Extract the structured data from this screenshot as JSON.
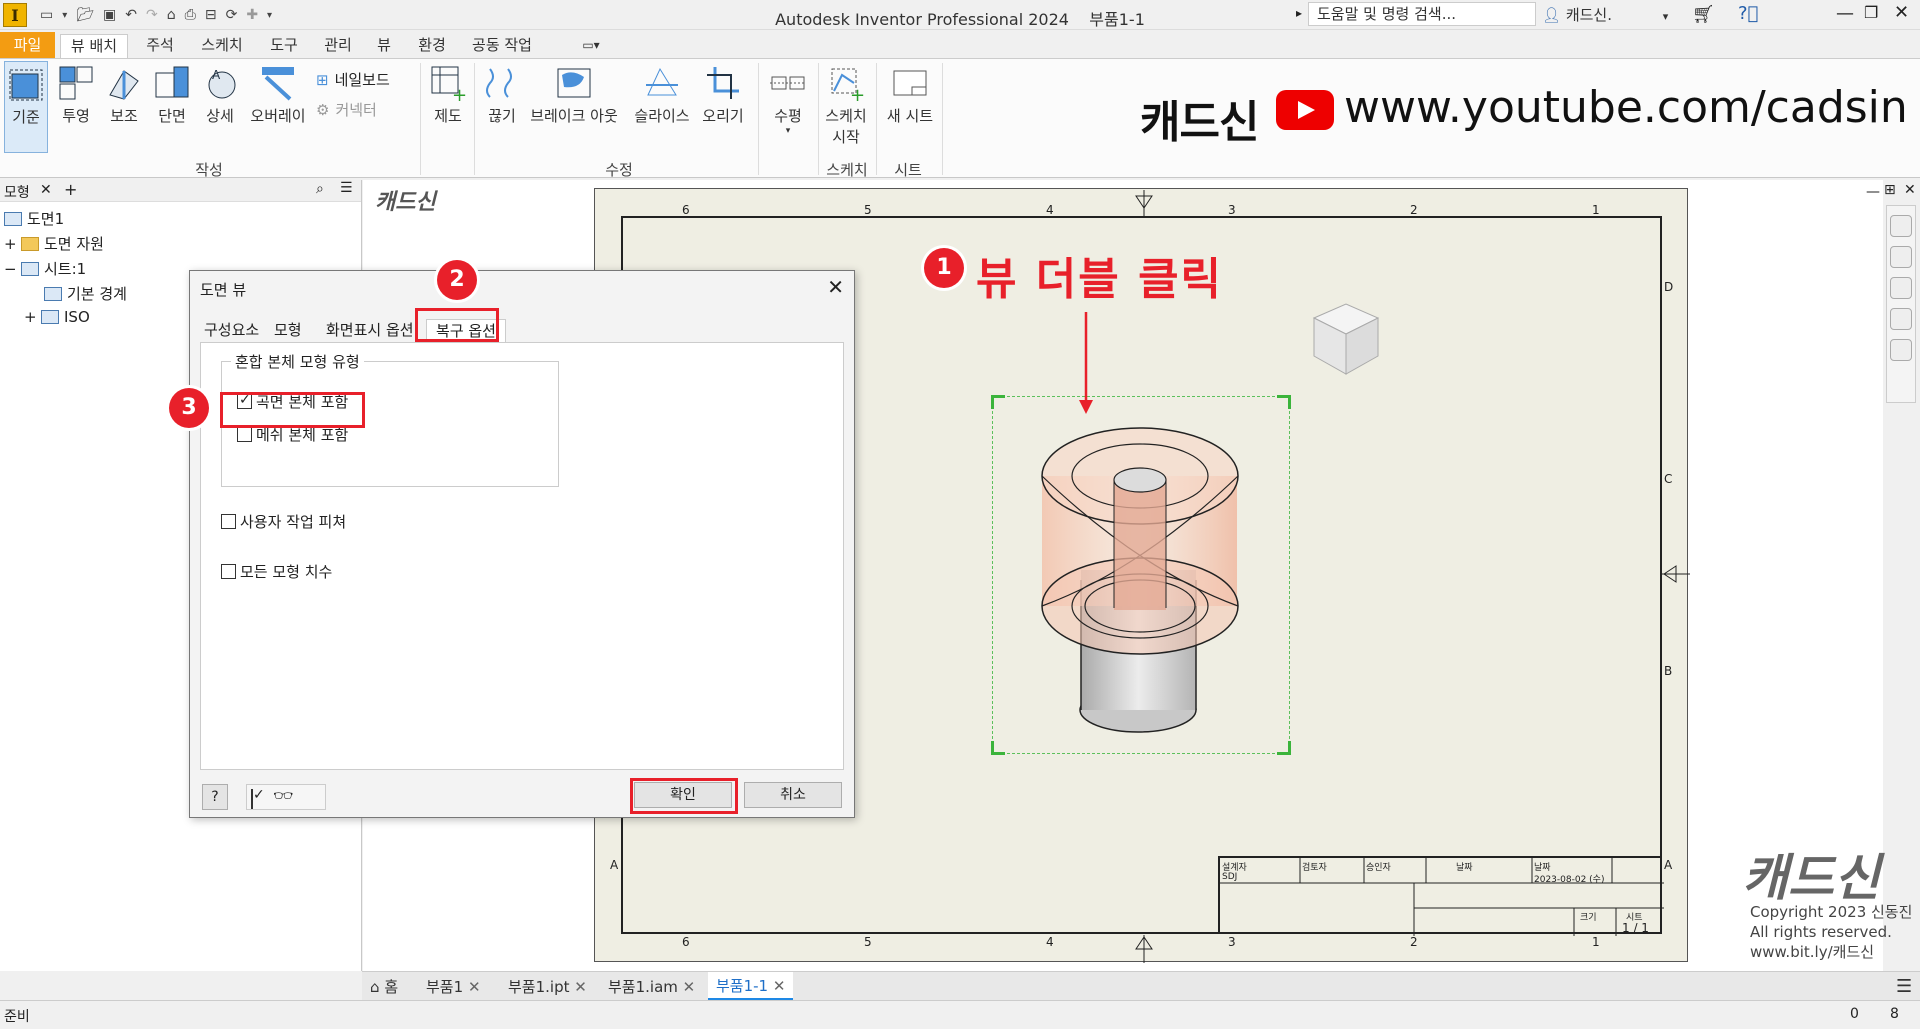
{
  "app": {
    "title": "Autodesk Inventor Professional 2024",
    "document": "부품1-1",
    "icon_letter": "I",
    "search_placeholder": "도움말 및 명령 검색...",
    "user": "캐드신."
  },
  "ribbon_tabs": [
    "파일",
    "뷰 배치",
    "주석",
    "스케치",
    "도구",
    "관리",
    "뷰",
    "환경",
    "공동 작업"
  ],
  "ribbon": {
    "create": {
      "group": "작성",
      "buttons": [
        "기준",
        "투영",
        "보조",
        "단면",
        "상세",
        "오버레이"
      ],
      "small": [
        "네일보드",
        "커넥터"
      ]
    },
    "draft": {
      "label": "제도"
    },
    "modify": {
      "group": "수정",
      "buttons": [
        "끊기",
        "브레이크 아웃",
        "슬라이스",
        "오리기"
      ]
    },
    "horizontal": {
      "label": "수평"
    },
    "sketch": {
      "group": "스케치",
      "label_line1": "스케치",
      "label_line2": "시작"
    },
    "sheet": {
      "group": "시트",
      "label": "새 시트"
    }
  },
  "promo": {
    "brand": "캐드신",
    "url": "www.youtube.com/cadsin"
  },
  "browser": {
    "tab": "모형",
    "items": [
      {
        "label": "도면1"
      },
      {
        "label": "도면 자원"
      },
      {
        "label": "시트:1"
      },
      {
        "label": "기본 경계"
      },
      {
        "label": "ISO"
      }
    ]
  },
  "canvas_watermark": "캐드신",
  "sheet": {
    "top_zones": [
      "6",
      "5",
      "4",
      "3",
      "2",
      "1"
    ],
    "bottom_zones": [
      "6",
      "5",
      "4",
      "3",
      "2",
      "1"
    ],
    "side_zones_right": [
      "D",
      "C",
      "B",
      "A"
    ],
    "side_zone_left": "A",
    "titleblock": {
      "designer_label": "설계자",
      "checker_label": "검토자",
      "approver_label": "승인자",
      "date_label": "날짜",
      "date2_label": "날짜",
      "designer": "SDJ",
      "date": "2023-08-02 (수)",
      "size_label": "크기",
      "sheet_label": "시트",
      "sheet": "1 / 1"
    }
  },
  "annotation": {
    "step1_badge": "1",
    "step1_text": "뷰 더블 클릭",
    "step2_badge": "2",
    "step3_badge": "3"
  },
  "dialog": {
    "title": "도면 뷰",
    "close": "✕",
    "tabs": [
      "구성요소",
      "모형",
      "화면표시 옵션",
      "복구 옵션"
    ],
    "group_label": "혼합 본체 모형 유형",
    "options": [
      {
        "label": "곡면 본체 포함",
        "checked": true
      },
      {
        "label": "메쉬 본체 포함",
        "checked": false
      },
      {
        "label": "사용자 작업 피쳐",
        "checked": false
      },
      {
        "label": "모든 모형 치수",
        "checked": false
      }
    ],
    "ok": "확인",
    "cancel": "취소",
    "help": "?"
  },
  "watermark": {
    "brand": "캐드신",
    "line1": "Copyright 2023 신동진",
    "line2": "All rights reserved.",
    "line3": "www.bit.ly/캐드신"
  },
  "doc_tabs": [
    "홈",
    "부품1",
    "부품1.ipt",
    "부품1.iam",
    "부품1-1"
  ],
  "status": {
    "text": "준비",
    "count1": "0",
    "count2": "8"
  },
  "colors": {
    "accent_orange": "#f39c12",
    "annotation_red": "#e8202a",
    "sheet_bg": "#efeee3",
    "view_frame": "#3bb43b"
  }
}
